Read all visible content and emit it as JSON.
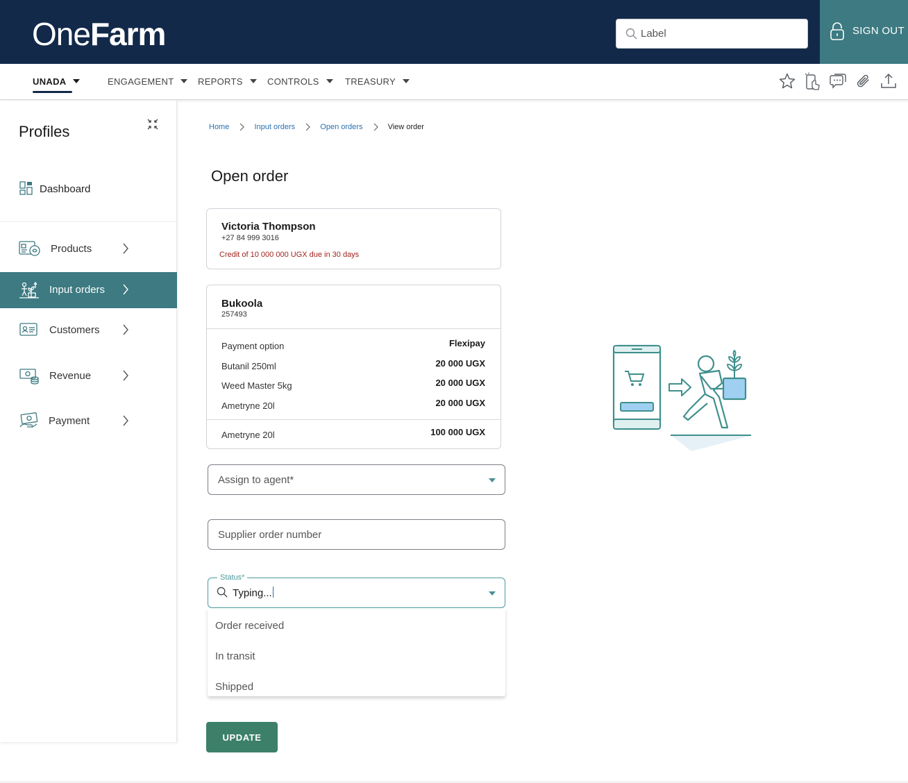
{
  "header": {
    "logo_light": "One",
    "logo_bold": "Farm",
    "search_placeholder": "Label",
    "signout_label": "SIGN OUT"
  },
  "nav": {
    "items": [
      {
        "label": "UNADA",
        "active": true
      },
      {
        "label": "ENGAGEMENT"
      },
      {
        "label": "REPORTS"
      },
      {
        "label": "CONTROLS"
      },
      {
        "label": "TREASURY"
      }
    ],
    "tools": [
      "star-icon",
      "touch-device-icon",
      "chat-icon",
      "paperclip-icon",
      "upload-icon"
    ]
  },
  "sidebar": {
    "title": "Profiles",
    "dashboard_label": "Dashboard",
    "items": [
      {
        "label": "Products",
        "icon": "products-icon"
      },
      {
        "label": "Input orders",
        "icon": "input-orders-icon",
        "active": true
      },
      {
        "label": "Customers",
        "icon": "customers-icon"
      },
      {
        "label": "Revenue",
        "icon": "revenue-icon"
      },
      {
        "label": "Payment",
        "icon": "payment-icon"
      }
    ]
  },
  "breadcrumb": [
    "Home",
    "Input orders",
    "Open orders",
    "View order"
  ],
  "page_title": "Open order",
  "customer": {
    "name": "Victoria Thompson",
    "phone": "+27 84 999 3016",
    "credit": "Credit of 10 000 000 UGX due in 30 days"
  },
  "order": {
    "name": "Bukoola",
    "code": "257493",
    "lines": [
      {
        "label": "Payment option",
        "value": "Flexipay"
      },
      {
        "label": "Butanil 250ml",
        "value": "20 000 UGX"
      },
      {
        "label": "Weed Master 5kg",
        "value": "20 000 UGX"
      },
      {
        "label": "Ametryne 20l",
        "value": "20 000 UGX"
      }
    ],
    "total": {
      "label": "Ametryne 20l",
      "value": "100 000 UGX"
    }
  },
  "form": {
    "agent_placeholder": "Assign to agent*",
    "supplier_placeholder": "Supplier order number",
    "status_label": "Status*",
    "status_value": "Typing...",
    "status_options": [
      "Order received",
      "In transit",
      "Shipped"
    ],
    "update_label": "UPDATE"
  },
  "colors": {
    "header_bg": "#12294a",
    "accent_teal": "#3d7a82",
    "button_green": "#3d8069",
    "credit_red": "#a0231c",
    "link_blue": "#2a6fb0"
  }
}
